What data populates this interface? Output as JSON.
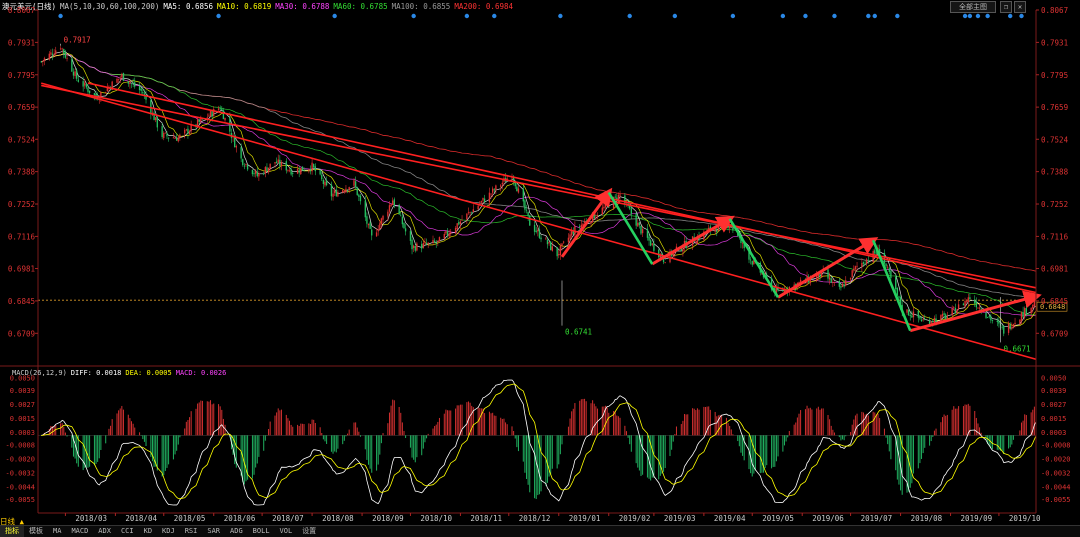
{
  "header": {
    "symbol": "澳元美元(日线)",
    "ma_params": "MA(5,10,30,60,100,200)",
    "ma_values": [
      {
        "label": "MA5: 0.6856",
        "color": "#ffffff"
      },
      {
        "label": "MA10: 0.6819",
        "color": "#ffff00"
      },
      {
        "label": "MA30: 0.6788",
        "color": "#ff44ff"
      },
      {
        "label": "MA60: 0.6785",
        "color": "#33dd33"
      },
      {
        "label": "MA100: 0.6855",
        "color": "#999999"
      },
      {
        "label": "MA200: 0.6984",
        "color": "#ff3333"
      }
    ],
    "main_button": "全部主图",
    "window_icons": [
      "restore-icon",
      "close-icon"
    ]
  },
  "macd_header": {
    "params": "MACD(26,12,9)",
    "values": [
      {
        "label": "DIFF: 0.0018",
        "color": "#ffffff"
      },
      {
        "label": "DEA: 0.0005",
        "color": "#ffff00"
      },
      {
        "label": "MACD: 0.0026",
        "color": "#ff44ff"
      }
    ]
  },
  "chart_data": [
    {
      "type": "candlestick",
      "title": "澳元美元(日线)",
      "y_ticks": [
        "0.8067",
        "0.7931",
        "0.7795",
        "0.7659",
        "0.7524",
        "0.7388",
        "0.7252",
        "0.7116",
        "0.6981",
        "0.6845",
        "0.6709"
      ],
      "ylim": [
        0.658,
        0.8067
      ],
      "x_ticks": [
        "2018/03",
        "2018/04",
        "2018/05",
        "2018/06",
        "2018/07",
        "2018/08",
        "2018/09",
        "2018/10",
        "2018/11",
        "2018/12",
        "2019/01",
        "2019/02",
        "2019/03",
        "2019/04",
        "2019/05",
        "2019/06",
        "2019/07",
        "2019/08",
        "2019/09",
        "2019/10"
      ],
      "xlim": [
        "2018/02/12",
        "2019/10/24"
      ],
      "annotations": [
        {
          "text": "0.7917",
          "x": "2018/02/26",
          "y": 0.7917,
          "color": "#ff4444"
        },
        {
          "text": "0.6741",
          "x": "2019/01/03",
          "y": 0.6741,
          "color": "#33dd33"
        },
        {
          "text": "0.6671",
          "x": "2019/10/02",
          "y": 0.6671,
          "color": "#33dd33"
        }
      ],
      "current_price": "0.6848",
      "close_path": [
        [
          "2018/02/14",
          0.785
        ],
        [
          "2018/02/26",
          0.7917
        ],
        [
          "2018/03/08",
          0.778
        ],
        [
          "2018/03/20",
          0.77
        ],
        [
          "2018/04/05",
          0.779
        ],
        [
          "2018/04/18",
          0.772
        ],
        [
          "2018/04/30",
          0.754
        ],
        [
          "2018/05/10",
          0.753
        ],
        [
          "2018/05/22",
          0.759
        ],
        [
          "2018/06/05",
          0.766
        ],
        [
          "2018/06/18",
          0.744
        ],
        [
          "2018/06/28",
          0.737
        ],
        [
          "2018/07/09",
          0.743
        ],
        [
          "2018/07/20",
          0.739
        ],
        [
          "2018/08/01",
          0.741
        ],
        [
          "2018/08/13",
          0.729
        ],
        [
          "2018/08/27",
          0.734
        ],
        [
          "2018/09/07",
          0.711
        ],
        [
          "2018/09/20",
          0.727
        ],
        [
          "2018/10/02",
          0.707
        ],
        [
          "2018/10/18",
          0.709
        ],
        [
          "2018/11/01",
          0.718
        ],
        [
          "2018/11/14",
          0.726
        ],
        [
          "2018/12/03",
          0.738
        ],
        [
          "2018/12/14",
          0.717
        ],
        [
          "2018/12/31",
          0.704
        ],
        [
          "2019/01/10",
          0.714
        ],
        [
          "2019/01/30",
          0.724
        ],
        [
          "2019/02/08",
          0.729
        ],
        [
          "2019/02/22",
          0.713
        ],
        [
          "2019/03/07",
          0.702
        ],
        [
          "2019/03/20",
          0.708
        ],
        [
          "2019/04/04",
          0.714
        ],
        [
          "2019/04/17",
          0.717
        ],
        [
          "2019/05/01",
          0.701
        ],
        [
          "2019/05/16",
          0.688
        ],
        [
          "2019/06/03",
          0.693
        ],
        [
          "2019/06/14",
          0.696
        ],
        [
          "2019/06/24",
          0.689
        ],
        [
          "2019/07/05",
          0.699
        ],
        [
          "2019/07/19",
          0.706
        ],
        [
          "2019/08/02",
          0.681
        ],
        [
          "2019/08/16",
          0.676
        ],
        [
          "2019/08/30",
          0.678
        ],
        [
          "2019/09/13",
          0.686
        ],
        [
          "2019/09/26",
          0.677
        ],
        [
          "2019/10/04",
          0.672
        ],
        [
          "2019/10/17",
          0.68
        ],
        [
          "2019/10/24",
          0.6848
        ]
      ],
      "trendlines": [
        {
          "from": [
            "2018/02/14",
            0.775
          ],
          "to": [
            "2019/10/24",
            0.69
          ]
        },
        {
          "from": [
            "2018/03/15",
            0.776
          ],
          "to": [
            "2019/10/24",
            0.688
          ]
        },
        {
          "from": [
            "2018/02/14",
            0.776
          ],
          "to": [
            "2019/10/24",
            0.66
          ]
        }
      ],
      "arrows": [
        {
          "from": [
            "2019/01/03",
            0.703
          ],
          "to": [
            "2019/02/01",
            0.73
          ]
        },
        {
          "from": [
            "2019/02/28",
            0.7
          ],
          "to": [
            "2019/04/17",
            0.719
          ]
        },
        {
          "from": [
            "2019/05/17",
            0.686
          ],
          "to": [
            "2019/07/15",
            0.71
          ]
        },
        {
          "from": [
            "2019/08/07",
            0.672
          ],
          "to": [
            "2019/10/24",
            0.6865
          ]
        }
      ],
      "down_legs": [
        {
          "from": [
            "2019/02/01",
            0.73
          ],
          "to": [
            "2019/02/28",
            0.7
          ]
        },
        {
          "from": [
            "2019/04/17",
            0.719
          ],
          "to": [
            "2019/05/17",
            0.686
          ]
        },
        {
          "from": [
            "2019/07/15",
            0.71
          ],
          "to": [
            "2019/08/07",
            0.672
          ]
        }
      ],
      "ma_series": [
        {
          "name": "MA5",
          "color": "#ffffff",
          "period": 5
        },
        {
          "name": "MA10",
          "color": "#ffff00",
          "period": 10
        },
        {
          "name": "MA30",
          "color": "#ff44ff",
          "period": 30
        },
        {
          "name": "MA60",
          "color": "#33dd33",
          "period": 60
        },
        {
          "name": "MA100",
          "color": "#999999",
          "period": 100
        },
        {
          "name": "MA200",
          "color": "#ff3333",
          "period": 200
        }
      ],
      "grid": false
    },
    {
      "type": "bar",
      "title": "MACD(26,12,9)",
      "y_ticks": [
        "0.0050",
        "0.0039",
        "0.0027",
        "0.0015",
        "0.0003",
        "-0.0008",
        "-0.0020",
        "-0.0032",
        "-0.0044",
        "-0.0055"
      ],
      "ylim": [
        -0.006,
        0.0052
      ],
      "series": [
        {
          "name": "DIFF",
          "color": "#ffffff"
        },
        {
          "name": "DEA",
          "color": "#ffff00"
        },
        {
          "name": "MACD",
          "color": "#ff44ff"
        }
      ]
    }
  ],
  "date_label": "日线",
  "tabs": [
    "指标",
    "模板",
    "MA",
    "MACD",
    "ADX",
    "CCI",
    "KD",
    "KDJ",
    "RSI",
    "SAR",
    "ADG",
    "BOLL",
    "VOL",
    "设置"
  ]
}
